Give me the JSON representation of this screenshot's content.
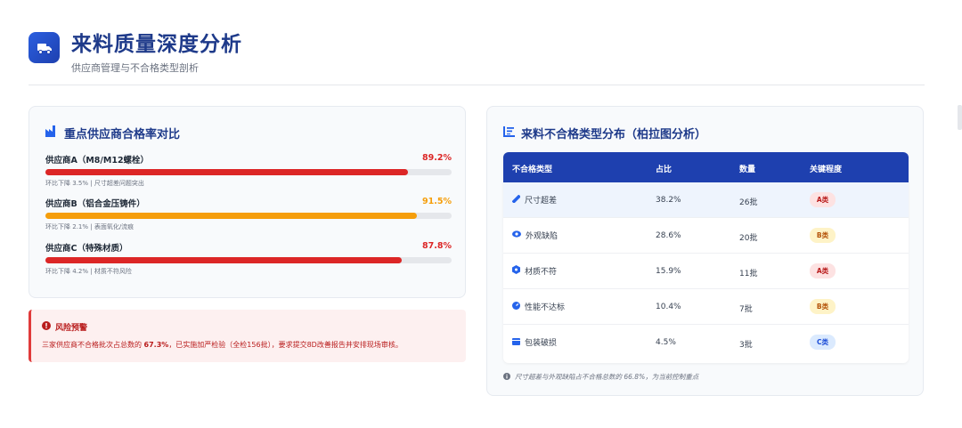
{
  "header": {
    "title": "来料质量深度分析",
    "subtitle": "供应商管理与不合格类型剖析",
    "logo_icon": "truck-icon",
    "accent_color": "#1e40af"
  },
  "suppliers_card": {
    "title": "重点供应商合格率对比",
    "title_icon": "factory-icon",
    "suppliers": [
      {
        "name": "供应商A（M8/M12螺栓）",
        "rate_label": "89.2%",
        "rate": 89.2,
        "color": "#dc2626",
        "note": "环比下降 3.5% | 尺寸超差问题突出"
      },
      {
        "name": "供应商B（铝合金压铸件）",
        "rate_label": "91.5%",
        "rate": 91.5,
        "color": "#f59e0b",
        "note": "环比下降 2.1% | 表面氧化/流痕"
      },
      {
        "name": "供应商C（特殊材质）",
        "rate_label": "87.8%",
        "rate": 87.8,
        "color": "#dc2626",
        "note": "环比下降 4.2% | 材质不符风险"
      }
    ]
  },
  "alert": {
    "title": "风险预警",
    "icon": "alert-circle-icon",
    "text_before": "三家供应商不合格批次占总数的 ",
    "text_bold": "67.3%",
    "text_after": "，已实施加严检验（全检156批），要求提交8D改善报告并安排现场审核。"
  },
  "defects_card": {
    "title": "来料不合格类型分布（柏拉图分析）",
    "title_icon": "list-chart-icon",
    "columns": [
      "不合格类型",
      "占比",
      "数量",
      "关键程度"
    ],
    "rows": [
      {
        "type": "尺寸超差",
        "icon": "ruler-icon",
        "share": "38.2%",
        "count": "26批",
        "level": "A类"
      },
      {
        "type": "外观缺陷",
        "icon": "eye-icon",
        "share": "28.6%",
        "count": "20批",
        "level": "B类"
      },
      {
        "type": "材质不符",
        "icon": "hexagon-icon",
        "share": "15.9%",
        "count": "11批",
        "level": "A类"
      },
      {
        "type": "性能不达标",
        "icon": "gauge-icon",
        "share": "10.4%",
        "count": "7批",
        "level": "B类"
      },
      {
        "type": "包装破损",
        "icon": "box-icon",
        "share": "4.5%",
        "count": "3批",
        "level": "C类"
      }
    ],
    "footnote": "尺寸超差与外观缺陷占不合格总数的 66.8%，为当前控制重点"
  }
}
